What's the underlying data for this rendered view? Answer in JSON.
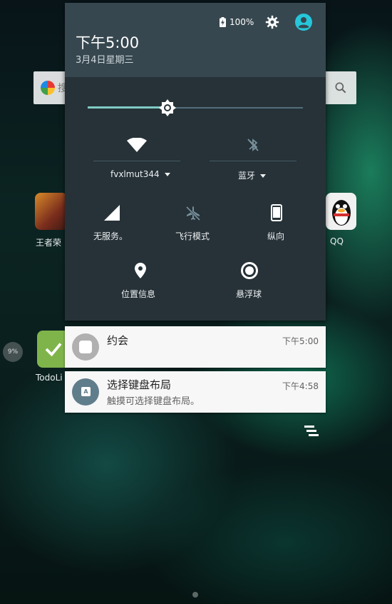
{
  "home": {
    "search_hint": "搜",
    "apps": [
      {
        "label": "王者荣"
      },
      {
        "label": "QQ"
      },
      {
        "label": "TodoLi"
      }
    ],
    "badge_percent": "9%"
  },
  "quick_settings": {
    "status": {
      "battery_percent": "100%"
    },
    "time": "下午5:00",
    "date": "3月4日星期三",
    "brightness_level": 0.37,
    "tiles": {
      "wifi": {
        "label": "fvxlmut344",
        "icon": "wifi-icon"
      },
      "bluetooth": {
        "label": "蓝牙",
        "icon": "bluetooth-off-icon"
      },
      "cellular": {
        "label": "无服务。",
        "icon": "cellular-signal-icon"
      },
      "airplane": {
        "label": "飞行模式",
        "icon": "airplane-off-icon"
      },
      "rotation": {
        "label": "纵向",
        "icon": "portrait-icon"
      },
      "location": {
        "label": "位置信息",
        "icon": "location-pin-icon"
      },
      "float_ball": {
        "label": "悬浮球",
        "icon": "float-ball-icon"
      }
    },
    "colors": {
      "panel": "#263238",
      "header": "#37474f",
      "accent": "#80cbc4",
      "avatar": "#26c6da"
    }
  },
  "notifications": [
    {
      "title": "约会",
      "time": "下午5:00",
      "body": "",
      "icon": "calendar-icon"
    },
    {
      "title": "选择键盘布局",
      "time": "下午4:58",
      "body": "触摸可选择键盘布局。",
      "icon": "keyboard-icon"
    }
  ]
}
